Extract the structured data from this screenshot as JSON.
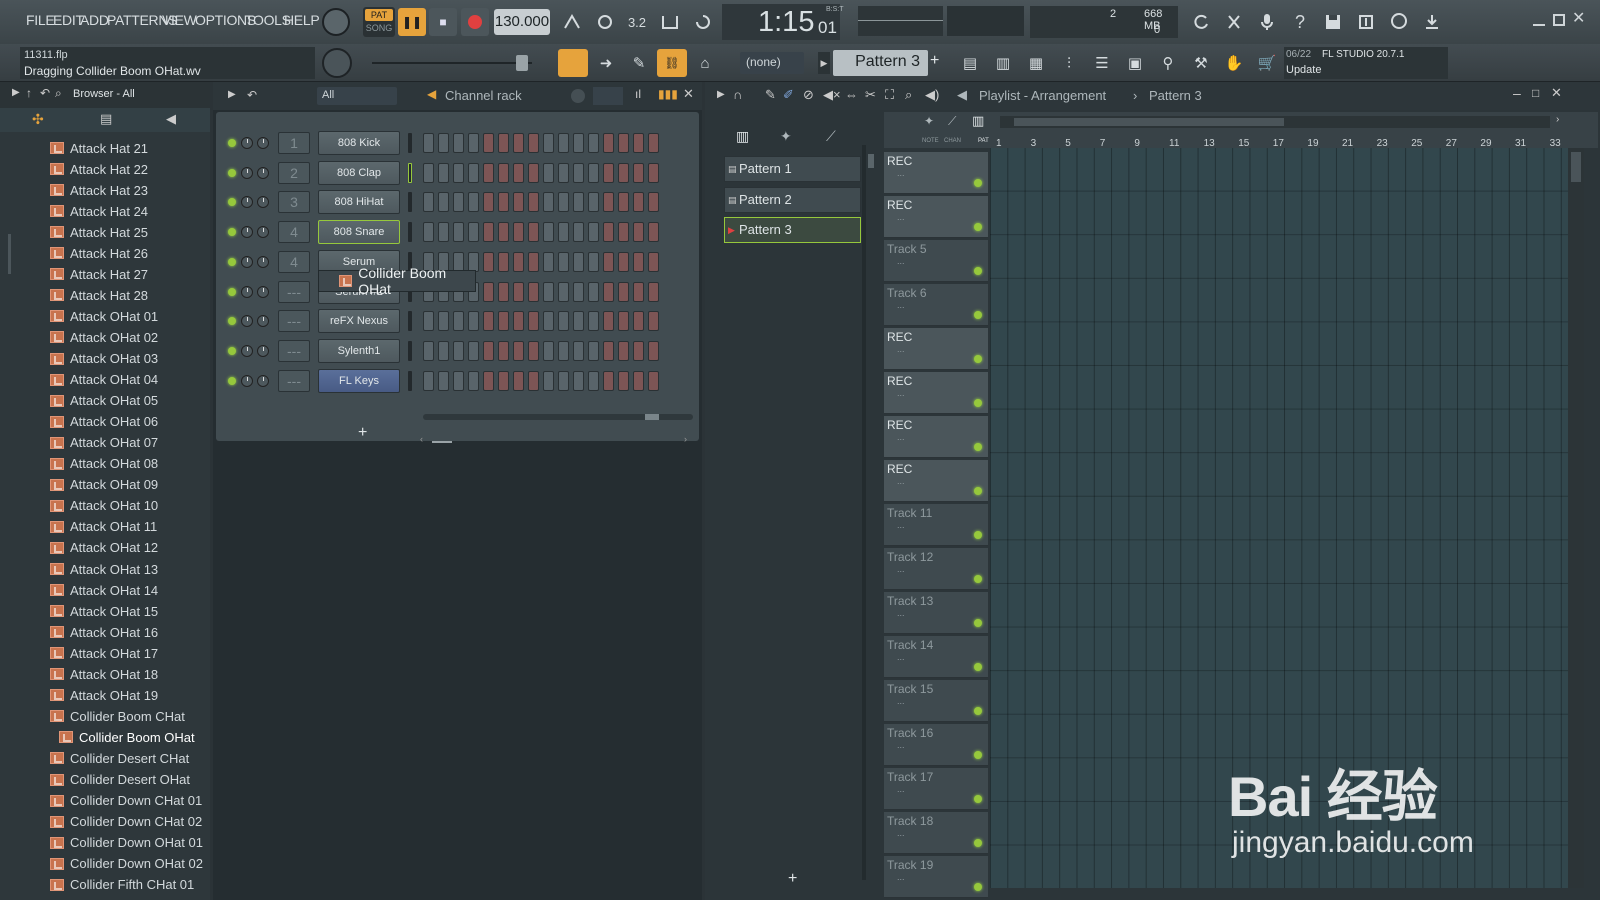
{
  "menu": [
    "FILE",
    "EDIT",
    "ADD",
    "PATTERNS",
    "VIEW",
    "OPTIONS",
    "TOOLS",
    "HELP"
  ],
  "transport": {
    "pat": "PAT",
    "song": "SONG",
    "tempo": "130.000",
    "time_main": "1:15",
    "time_sub": "01",
    "time_label": "B:S:T",
    "cpu_num": "2",
    "memory": "668 MB",
    "poly": "0"
  },
  "hint": {
    "file": "11311.flp",
    "message": "Dragging Collider Boom OHat.wv"
  },
  "pattern_selector": {
    "none": "(none)",
    "current": "Pattern 3",
    "add": "+"
  },
  "news": {
    "date": "06/22",
    "product": "FL STUDIO 20.7.1",
    "action": "Update"
  },
  "browser": {
    "title": "Browser - All",
    "items": [
      "Attack Hat 21",
      "Attack Hat 22",
      "Attack Hat 23",
      "Attack Hat 24",
      "Attack Hat 25",
      "Attack Hat 26",
      "Attack Hat 27",
      "Attack Hat 28",
      "Attack OHat 01",
      "Attack OHat 02",
      "Attack OHat 03",
      "Attack OHat 04",
      "Attack OHat 05",
      "Attack OHat 06",
      "Attack OHat 07",
      "Attack OHat 08",
      "Attack OHat 09",
      "Attack OHat 10",
      "Attack OHat 11",
      "Attack OHat 12",
      "Attack OHat 13",
      "Attack OHat 14",
      "Attack OHat 15",
      "Attack OHat 16",
      "Attack OHat 17",
      "Attack OHat 18",
      "Attack OHat 19",
      "Collider Boom CHat",
      "Collider Boom OHat",
      "Collider Desert CHat",
      "Collider Desert OHat",
      "Collider Down CHat 01",
      "Collider Down CHat 02",
      "Collider Down OHat 01",
      "Collider Down OHat 02",
      "Collider Fifth CHat 01"
    ]
  },
  "channel_rack": {
    "title": "Channel rack",
    "filter": "All",
    "add": "+",
    "drag_label": "Collider Boom OHat",
    "channels": [
      {
        "num": "1",
        "name": "808 Kick"
      },
      {
        "num": "2",
        "name": "808 Clap"
      },
      {
        "num": "3",
        "name": "808 HiHat"
      },
      {
        "num": "4",
        "name": "808 Snare"
      },
      {
        "num": "4",
        "name": "Serum"
      },
      {
        "num": "---",
        "name": "Serum #2"
      },
      {
        "num": "---",
        "name": "reFX Nexus"
      },
      {
        "num": "---",
        "name": "Sylenth1"
      },
      {
        "num": "---",
        "name": "FL Keys"
      }
    ]
  },
  "playlist": {
    "title": "Playlist - Arrangement",
    "crumb": "Pattern 3",
    "cols": [
      "NOTE",
      "CHAN",
      "PAT"
    ],
    "patterns": [
      "Pattern 1",
      "Pattern 2",
      "Pattern 3"
    ],
    "add": "+",
    "ruler": [
      "1",
      "3",
      "5",
      "7",
      "9",
      "11",
      "13",
      "15",
      "17",
      "19",
      "21",
      "23",
      "25",
      "27",
      "29",
      "31",
      "33"
    ],
    "tracks": [
      "REC",
      "REC",
      "Track 5",
      "Track 6",
      "REC",
      "REC",
      "REC",
      "REC",
      "Track 11",
      "Track 12",
      "Track 13",
      "Track 14",
      "Track 15",
      "Track 16",
      "Track 17",
      "Track 18",
      "Track 19"
    ],
    "track_sub": "..."
  },
  "watermark": {
    "logo": "Bai 经验",
    "url": "jingyan.baidu.com"
  }
}
